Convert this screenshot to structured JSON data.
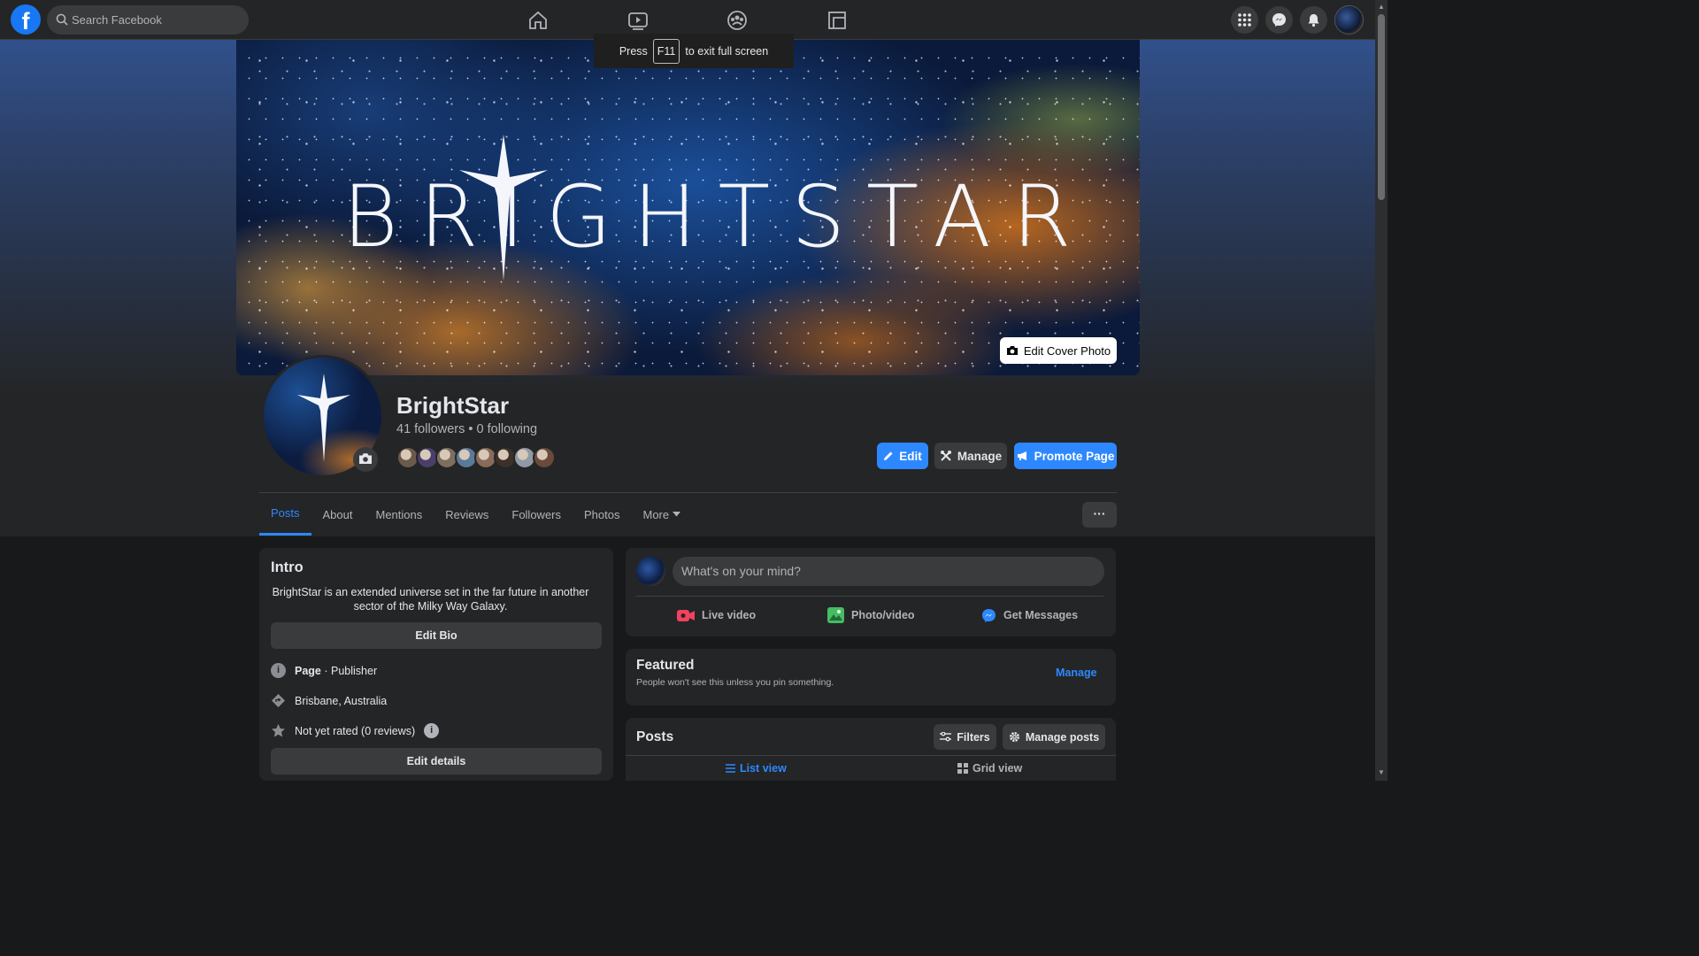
{
  "topbar": {
    "search_placeholder": "Search Facebook",
    "nav_icons": [
      "home-icon",
      "watch-icon",
      "groups-icon",
      "pages-icon"
    ],
    "right_icons": [
      "menu-icon",
      "messenger-icon",
      "notifications-icon",
      "account-icon"
    ]
  },
  "fullscreen_notice": {
    "press": "Press",
    "key": "F11",
    "rest": "to exit full screen"
  },
  "cover": {
    "brand": "BRIGHTSTAR",
    "edit_cover_label": "Edit Cover Photo"
  },
  "page": {
    "name": "BrightStar",
    "stats": "41 followers • 0 following",
    "follower_avatar_colors": [
      "#6b5a4a",
      "#4a3f6b",
      "#7d6e5e",
      "#5a7a9a",
      "#8a6a5a",
      "#3d2f2a",
      "#8f9aa5",
      "#6a4a3a"
    ]
  },
  "actions": {
    "edit": "Edit",
    "manage": "Manage",
    "promote": "Promote Page"
  },
  "tabs": [
    "Posts",
    "About",
    "Mentions",
    "Reviews",
    "Followers",
    "Photos",
    "More"
  ],
  "more_menu_label": "···",
  "intro": {
    "title": "Intro",
    "bio": "BrightStar is an extended universe set in the far future in another sector of the Milky Way Galaxy.",
    "edit_bio": "Edit Bio",
    "category_bold": "Page",
    "category_rest": " · Publisher",
    "location": "Brisbane, Australia",
    "rating": "Not yet rated (0 reviews)",
    "edit_details": "Edit details"
  },
  "composer": {
    "placeholder": "What's on your mind?",
    "live": "Live video",
    "photo": "Photo/video",
    "messages": "Get Messages"
  },
  "featured": {
    "title": "Featured",
    "subtitle": "People won't see this unless you pin something.",
    "manage": "Manage"
  },
  "posts": {
    "title": "Posts",
    "filters": "Filters",
    "manage_posts": "Manage posts",
    "list_view": "List view",
    "grid_view": "Grid view"
  },
  "colors": {
    "accent": "#2d88ff",
    "bg": "#18191a",
    "card": "#242526"
  }
}
